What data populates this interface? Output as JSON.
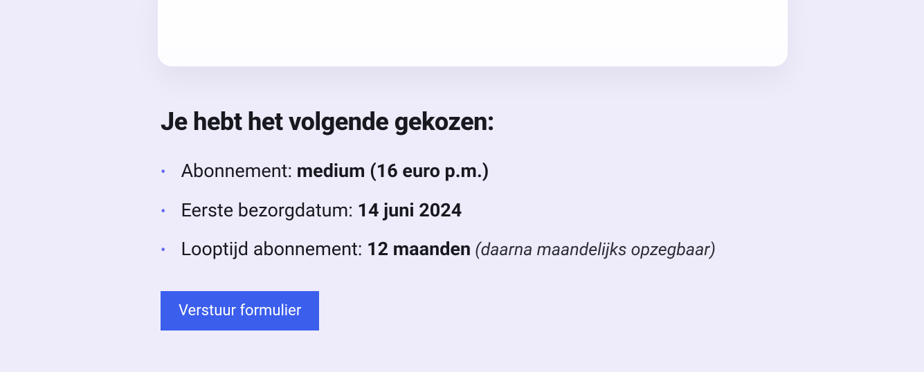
{
  "summary": {
    "heading": "Je hebt het volgende gekozen:",
    "items": [
      {
        "label": "Abonnement: ",
        "value": "medium (16 euro p.m.)",
        "note": ""
      },
      {
        "label": "Eerste bezorgdatum: ",
        "value": "14 juni 2024",
        "note": ""
      },
      {
        "label": "Looptijd abonnement: ",
        "value": "12 maanden",
        "note": " (daarna maandelijks opzegbaar)"
      }
    ]
  },
  "actions": {
    "submit_label": "Verstuur formulier"
  }
}
